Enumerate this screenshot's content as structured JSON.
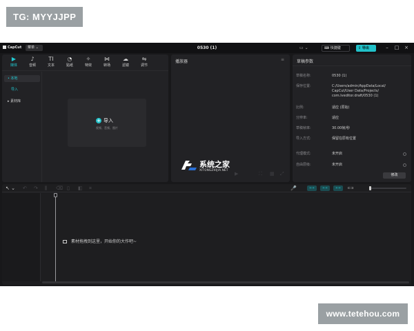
{
  "overlay": {
    "top_badge": "TG: MYYJJPP",
    "bottom_badge": "www.tetehou.com"
  },
  "titlebar": {
    "app_name": "CapCut",
    "menu_label": "菜单 ⌄",
    "title": "0530 (1)",
    "layout_icon": "▭ ⌄",
    "shortcut_label": "⌨ 快捷键",
    "export_label": "⇪ 导出",
    "minimize": "–",
    "maximize": "□",
    "close": "×"
  },
  "media_panel": {
    "tabs": [
      {
        "icon": "▶",
        "label": "媒体"
      },
      {
        "icon": "♪",
        "label": "音频"
      },
      {
        "icon": "TI",
        "label": "文本"
      },
      {
        "icon": "◔",
        "label": "贴纸"
      },
      {
        "icon": "✧",
        "label": "特效"
      },
      {
        "icon": "⋈",
        "label": "转场"
      },
      {
        "icon": "☁",
        "label": "滤镜"
      },
      {
        "icon": "⇋",
        "label": "调节"
      }
    ],
    "nav": {
      "local": "• 本地",
      "import": "导入",
      "library": "▸ 素材库"
    },
    "import_box": {
      "plus": "+",
      "label": "导入",
      "hint": "视频、音频、图片"
    }
  },
  "player_panel": {
    "title": "播放器",
    "menu_icon": "≡",
    "play_icon": "▶",
    "fit_icon": "⛶",
    "ratio_icon": "▦",
    "fullscreen_icon": "⤢"
  },
  "props_panel": {
    "title": "草稿参数",
    "rows": [
      {
        "key": "草稿名称:",
        "value": "0530 (1)"
      },
      {
        "key": "保存位置:",
        "value": "C:/Users/admin/AppData/Local/\nCapCut/User Data/Projects/\ncom.lveditor.draft/0530 (1)"
      },
      {
        "key": "比例:",
        "value": "适应 (原始)"
      },
      {
        "key": "分辨率:",
        "value": "适应"
      },
      {
        "key": "草稿帧率:",
        "value": "30.00帧/秒"
      },
      {
        "key": "导入方式:",
        "value": "保留在原有位置"
      },
      {
        "key": "代理模式:",
        "value": "未开启"
      },
      {
        "key": "自由层级:",
        "value": "未开启"
      }
    ],
    "modify_label": "修改"
  },
  "timeline": {
    "select_tool": "↖ ⌄",
    "mic_icon": "🎤",
    "snap_buttons": [
      "⟷",
      "⟷",
      "⟷"
    ],
    "split_icon": "⊏⊐",
    "hint": "素材拖拽到这里，开始你的大作吧~"
  },
  "watermark": {
    "title": "系统之家",
    "subtitle": "XITONGZHIJIA.NET"
  }
}
